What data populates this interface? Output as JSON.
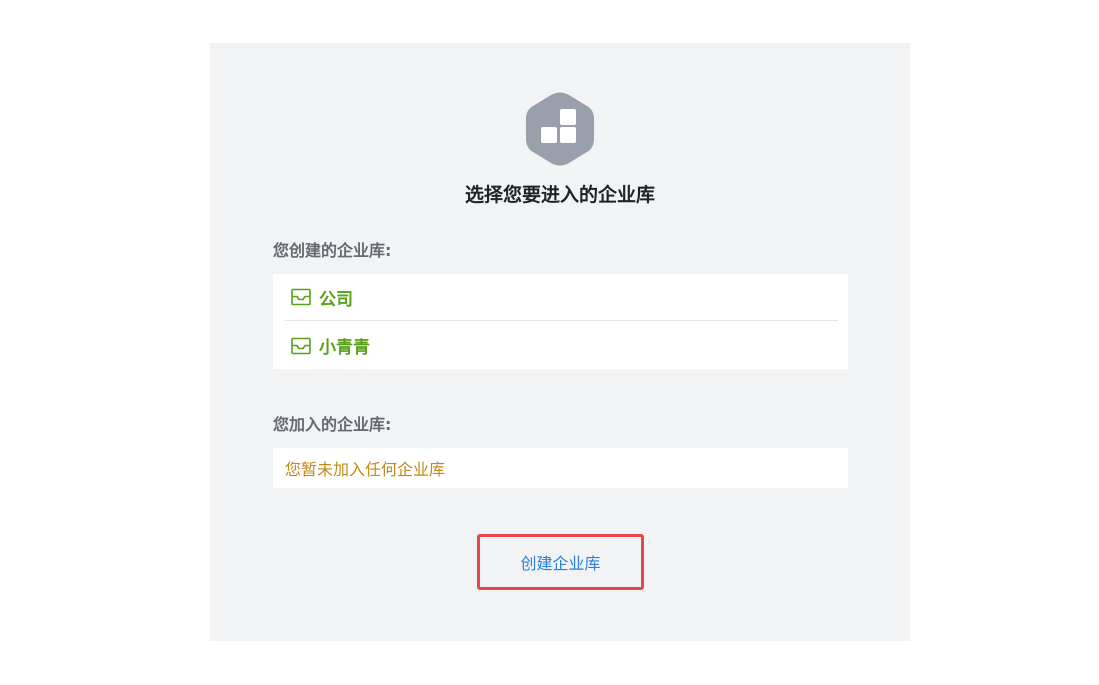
{
  "heading": "选择您要进入的企业库",
  "created_section": {
    "label": "您创建的企业库:",
    "items": [
      {
        "label": "公司",
        "icon": "inbox-icon"
      },
      {
        "label": "小青青",
        "icon": "inbox-icon"
      }
    ]
  },
  "joined_section": {
    "label": "您加入的企业库:",
    "empty_text": "您暂未加入任何企业库"
  },
  "create_button": {
    "label": "创建企业库"
  },
  "colors": {
    "card_bg": "#f2f3f5",
    "item_green": "#5aa01b",
    "empty_orange": "#c28a16",
    "link_blue": "#2b7fd9",
    "highlight_red": "#e5474b",
    "logo_gray": "#9aa0ab"
  },
  "logo_icon": "blocks-hexagon-icon"
}
